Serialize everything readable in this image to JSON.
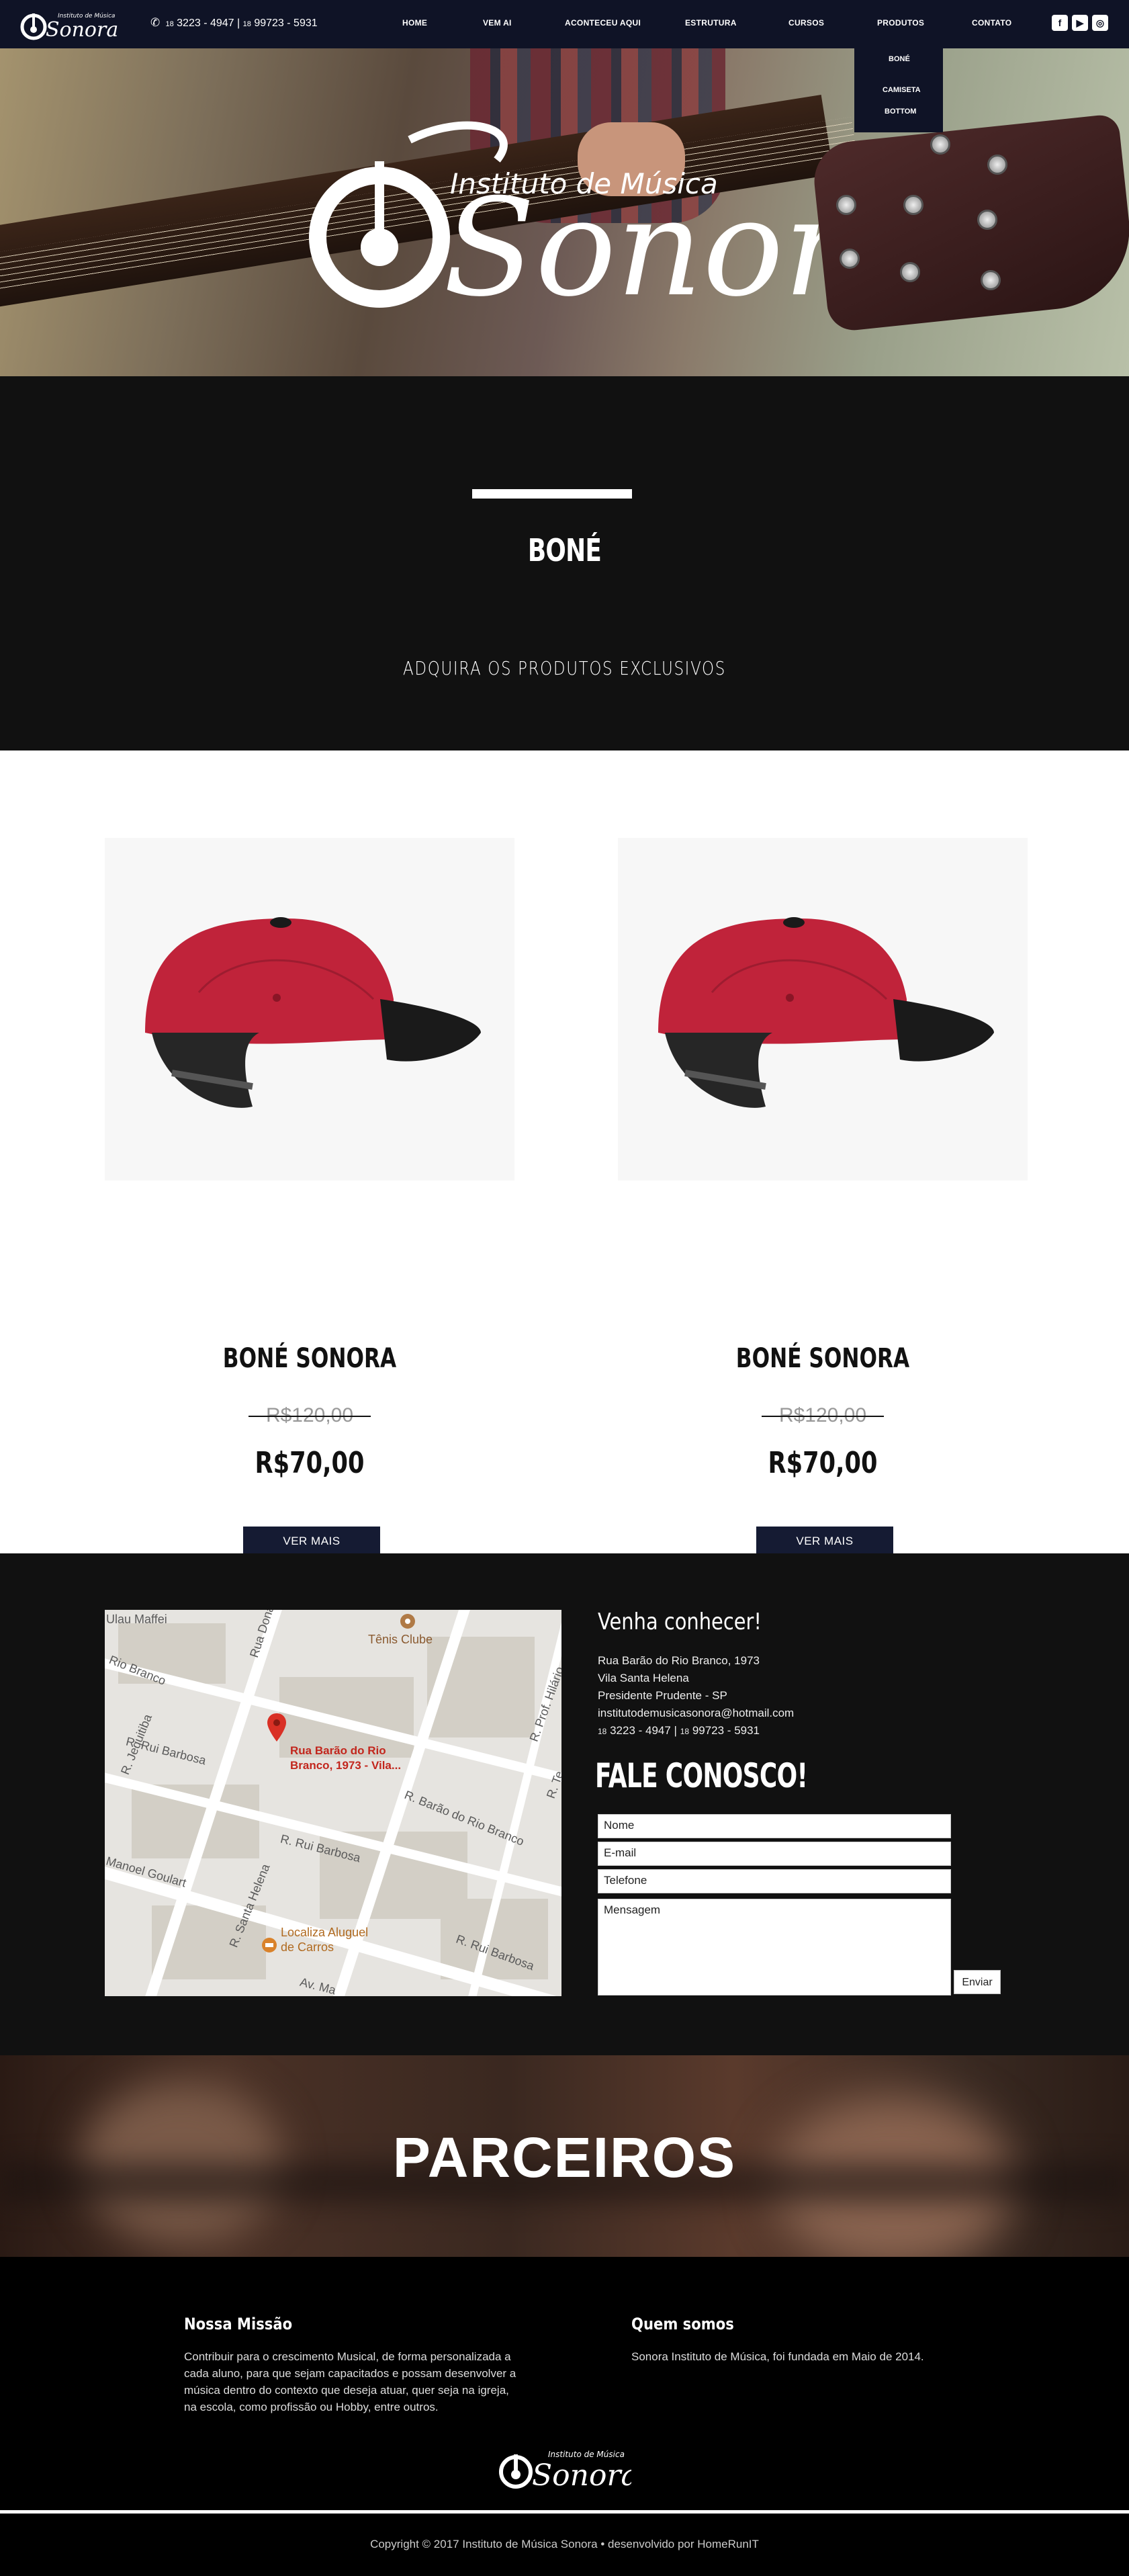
{
  "header": {
    "logo_text": "Sonora",
    "logo_subtext": "Instituto de Música",
    "phone": {
      "ddd1": "18",
      "number1": "3223 - 4947",
      "separator": "|",
      "ddd2": "18",
      "number2": "99723 - 5931"
    },
    "nav": [
      {
        "label": "HOME"
      },
      {
        "label": "VEM AI"
      },
      {
        "label": "ACONTECEU AQUI"
      },
      {
        "label": "ESTRUTURA"
      },
      {
        "label": "CURSOS"
      },
      {
        "label": "PRODUTOS"
      },
      {
        "label": "CONTATO"
      }
    ],
    "produtos_dropdown": [
      "BONÉ",
      "CAMISETA",
      "BOTTOM"
    ],
    "socials": [
      "facebook-icon",
      "youtube-icon",
      "instagram-icon"
    ]
  },
  "hero": {
    "logo_text": "Sonora",
    "logo_subtext": "Instituto de Música"
  },
  "banner": {
    "title": "BONÉ",
    "subtitle": "ADQUIRA OS PRODUTOS EXCLUSIVOS"
  },
  "products": [
    {
      "name": "BONÉ SONORA",
      "old_price": "R$120,00",
      "price": "R$70,00",
      "button": "VER MAIS"
    },
    {
      "name": "BONÉ SONORA",
      "old_price": "R$120,00",
      "price": "R$70,00",
      "button": "VER MAIS"
    }
  ],
  "map": {
    "pin_label_line1": "Rua Barão do Rio",
    "pin_label_line2": "Branco, 1973 -  Vila...",
    "poi1": "Tênis Clube",
    "poi2_line1": "Localiza Aluguel",
    "poi2_line2": "de Carros",
    "streets": [
      "Ulau Maffei",
      "Rua Dona Militã",
      "Rio Branco",
      "R. Jequitiba",
      "R. Rui Barbosa",
      "R. Rui Barbosa",
      "R. Barão do Rio Branco",
      "R. Prof. Hilário",
      "Manoel Goulart",
      "R. Santa Helena",
      "R. Rui Barbosa",
      "Av. Ma",
      "R. Te"
    ]
  },
  "contact": {
    "heading": "Venha conhecer!",
    "address": [
      "Rua Barão do Rio Branco, 1973",
      "Vila Santa Helena",
      "Presidente Prudente - SP",
      "institutodemusicasonora@hotmail.com"
    ],
    "phone_line": {
      "ddd1": "18",
      "n1": "3223 - 4947 |",
      "ddd2": "18",
      "n2": "99723 - 5931"
    },
    "form_title": "FALE CONOSCO!",
    "fields": {
      "name": "Nome",
      "email": "E-mail",
      "phone": "Telefone",
      "message": "Mensagem"
    },
    "send": "Enviar"
  },
  "partners": {
    "title": "PARCEIROS"
  },
  "footer": {
    "mission_title": "Nossa Missão",
    "mission_lines": [
      "Contribuir para o crescimento Musical, de forma personalizada a",
      "cada aluno, para que sejam capacitados e possam desenvolver a",
      "música dentro do contexto que deseja atuar, quer seja na igreja,",
      "na escola, como profissão ou Hobby, entre outros."
    ],
    "about_title": "Quem somos",
    "about_text": "Sonora Instituto de Música, foi fundada em Maio de 2014.",
    "copyright": "Copyright © 2017 Instituto de Música Sonora  •  desenvolvido por HomeRunIT"
  },
  "colors": {
    "nav_bg": "#0f1326",
    "button_bg": "#151b33",
    "cap_red": "#c0233a",
    "cap_brim": "#1a1a1a",
    "pin_red": "#d93025"
  }
}
